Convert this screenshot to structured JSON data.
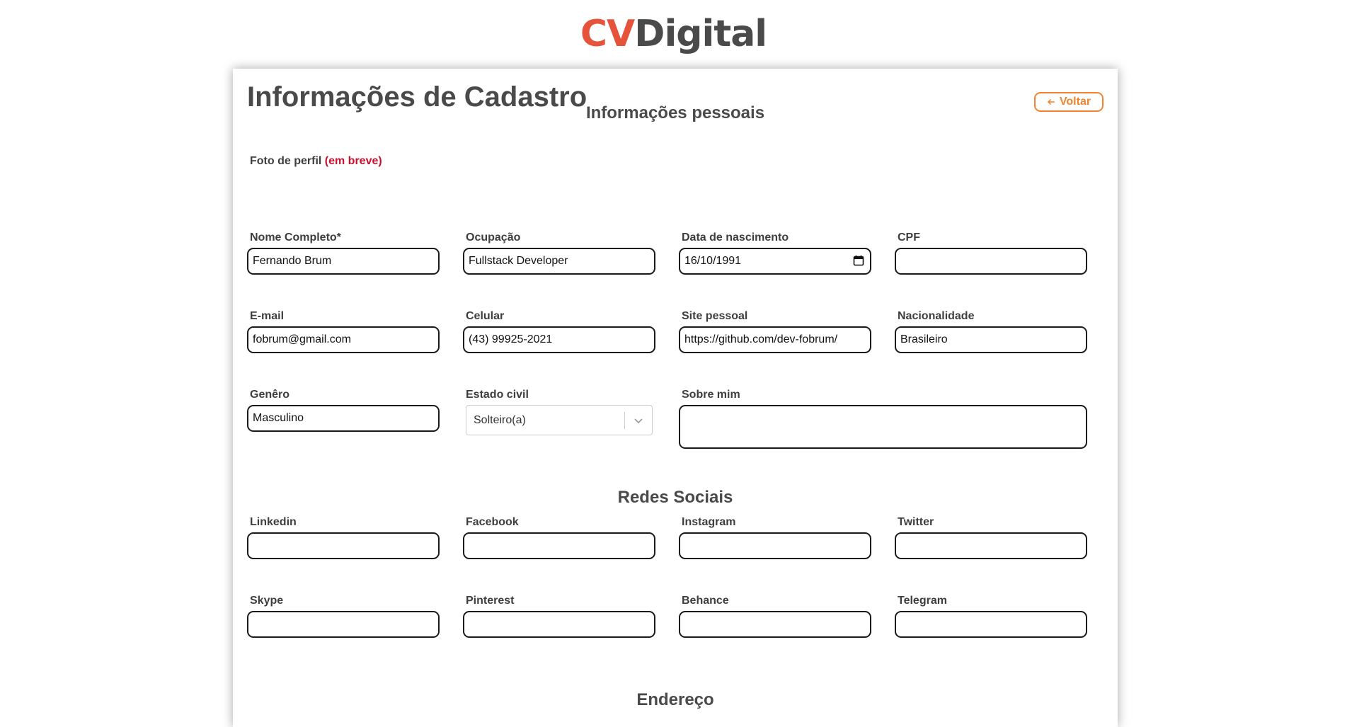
{
  "brand": {
    "part1": "CV",
    "part2": "Digital"
  },
  "page": {
    "title": "Informações de Cadastro",
    "back_label": "Voltar"
  },
  "personal": {
    "section_title": "Informações pessoais",
    "photo_label": "Foto de perfil",
    "photo_note": "(em breve)",
    "full_name": {
      "label": "Nome Completo*",
      "value": "Fernando Brum"
    },
    "occupation": {
      "label": "Ocupação",
      "value": "Fullstack Developer"
    },
    "birth_date": {
      "label": "Data de nascimento",
      "value": "16/10/1991"
    },
    "cpf": {
      "label": "CPF",
      "value": ""
    },
    "email": {
      "label": "E-mail",
      "value": "fobrum@gmail.com"
    },
    "phone": {
      "label": "Celular",
      "value": "(43) 99925-2021"
    },
    "website": {
      "label": "Site pessoal",
      "value": "https://github.com/dev-fobrum/"
    },
    "nationality": {
      "label": "Nacionalidade",
      "value": "Brasileiro"
    },
    "gender": {
      "label": "Genêro",
      "value": "Masculino"
    },
    "marital_status": {
      "label": "Estado civil",
      "value": "Solteiro(a)"
    },
    "about": {
      "label": "Sobre mim",
      "value": ""
    }
  },
  "social": {
    "section_title": "Redes Sociais",
    "linkedin": {
      "label": "Linkedin",
      "value": ""
    },
    "facebook": {
      "label": "Facebook",
      "value": ""
    },
    "instagram": {
      "label": "Instagram",
      "value": ""
    },
    "twitter": {
      "label": "Twitter",
      "value": ""
    },
    "skype": {
      "label": "Skype",
      "value": ""
    },
    "pinterest": {
      "label": "Pinterest",
      "value": ""
    },
    "behance": {
      "label": "Behance",
      "value": ""
    },
    "telegram": {
      "label": "Telegram",
      "value": ""
    }
  },
  "address": {
    "section_title": "Endereço"
  },
  "colors": {
    "brand_cv": "#e4533a",
    "brand_digital": "#4a4a4a",
    "accent": "#f0832e",
    "note": "#c8102e"
  },
  "icons": {
    "back": "arrow-left-icon",
    "calendar": "calendar-icon",
    "dropdown": "chevron-down-icon"
  }
}
